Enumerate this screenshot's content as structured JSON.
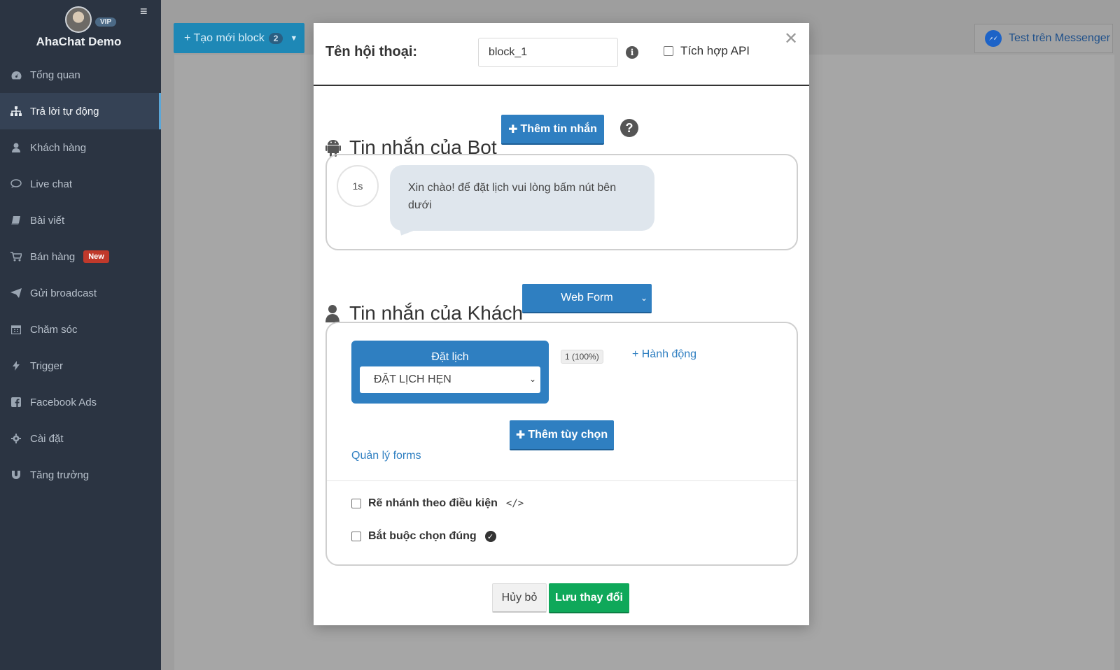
{
  "sidebar": {
    "brand": "AhaChat Demo",
    "vip_badge": "VIP",
    "items": [
      {
        "label": "Tổng quan",
        "icon": "dashboard-icon"
      },
      {
        "label": "Trả lời tự động",
        "icon": "sitemap-icon",
        "active": true
      },
      {
        "label": "Khách hàng",
        "icon": "user-icon"
      },
      {
        "label": "Live chat",
        "icon": "chat-icon"
      },
      {
        "label": "Bài viết",
        "icon": "book-icon"
      },
      {
        "label": "Bán hàng",
        "icon": "cart-icon",
        "badge": "New"
      },
      {
        "label": "Gửi broadcast",
        "icon": "paper-plane-icon"
      },
      {
        "label": "Chăm sóc",
        "icon": "calendar-icon"
      },
      {
        "label": "Trigger",
        "icon": "bolt-icon"
      },
      {
        "label": "Facebook Ads",
        "icon": "facebook-icon"
      },
      {
        "label": "Cài đặt",
        "icon": "gear-icon"
      },
      {
        "label": "Tăng trưởng",
        "icon": "magnet-icon"
      }
    ]
  },
  "toolbar": {
    "new_block_label": "+ Tạo mới block",
    "new_block_count": "2",
    "test_messenger_label": "Test trên Messenger"
  },
  "modal": {
    "conversation_label": "Tên hội thoại:",
    "conversation_name": "block_1",
    "api_label": "Tích hợp API",
    "bot_section": {
      "title": "Tin nhắn của Bot",
      "add_message_label": "Thêm tin nhắn",
      "delay": "1s",
      "message": "Xin chào! để đặt lịch vui lòng bấm nút bên dưới"
    },
    "customer_section": {
      "title": "Tin nhắn của Khách",
      "type_selected": "Web Form",
      "card_title": "Đặt lịch",
      "card_option": "ĐẶT LỊCH HẸN",
      "stat": "1 (100%)",
      "action_link": "+ Hành động",
      "add_option_label": "Thêm tùy chọn",
      "manage_forms_link": "Quản lý forms",
      "branch_label": "Rẽ nhánh theo điều kiện",
      "required_label": "Bắt buộc chọn đúng"
    },
    "cancel_label": "Hủy bỏ",
    "save_label": "Lưu thay đổi"
  },
  "colors": {
    "sidebar_bg": "#2b3442",
    "primary": "#2f7fc1",
    "success": "#0fa85a",
    "new_badge": "#c0392b"
  }
}
